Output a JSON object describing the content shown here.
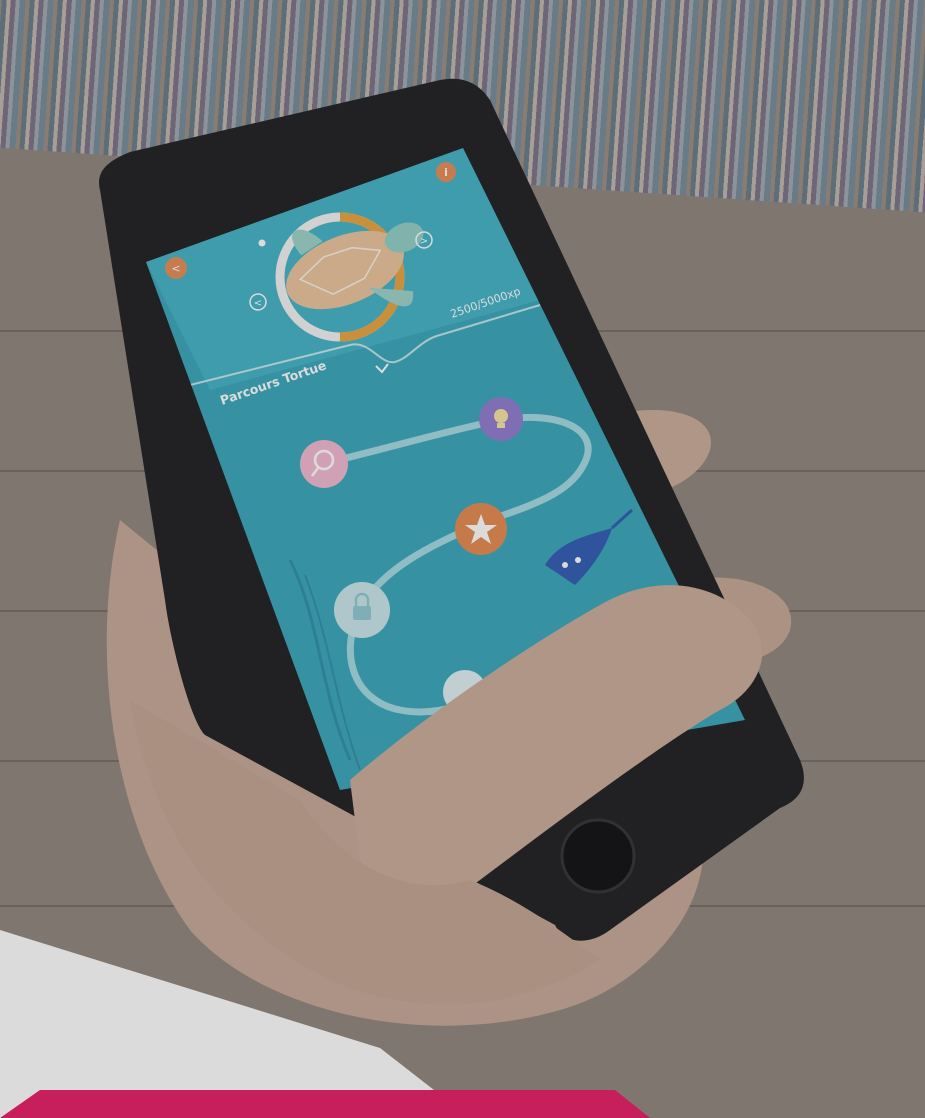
{
  "app": {
    "course_title": "Parcours Tortue",
    "xp_progress": "2500/5000xp",
    "xp_fraction": 0.5
  },
  "icons": {
    "back": "back-icon",
    "info": "info-icon",
    "prev": "chevron-left-icon",
    "next": "chevron-right-icon",
    "expand": "chevron-down-icon",
    "search": "magnifier-icon",
    "idea": "lightbulb-icon",
    "star": "star-icon",
    "lock": "lock-icon"
  },
  "colors": {
    "screen": "#35a6bb",
    "accent_orange": "#e58b55",
    "accent_pink": "#e41a64",
    "search_node": "#f1b9d1",
    "idea_node": "#8e7ad0",
    "star_node": "#e5894f",
    "lock_node": "#c9e7ec"
  }
}
